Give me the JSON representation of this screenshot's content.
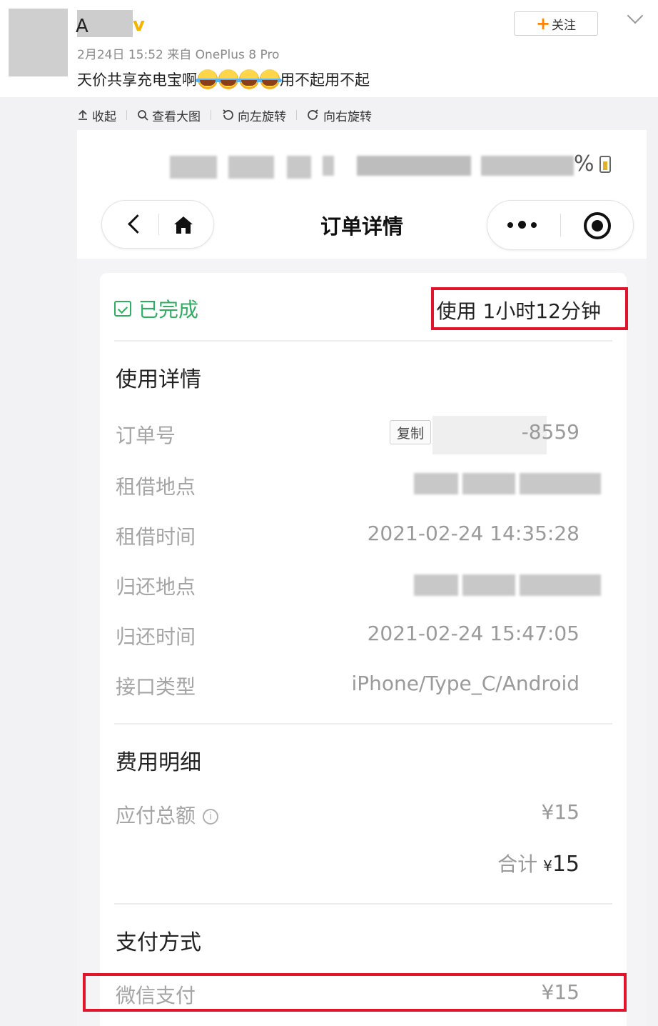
{
  "post": {
    "username_initial": "A",
    "verified_badge": "v",
    "meta": "2月24日 15:52 来自 OnePlus 8 Pro",
    "text_before": "天价共享充电宝啊",
    "emoji_icons": [
      "laugh-cry-emoji",
      "laugh-cry-emoji",
      "laugh-cry-emoji",
      "laugh-cry-emoji"
    ],
    "text_after": "用不起用不起",
    "follow_plus": "+",
    "follow_label": "关注"
  },
  "toolbar": {
    "collapse": "收起",
    "view_large": "查看大图",
    "rotate_left": "向左旋转",
    "rotate_right": "向右旋转"
  },
  "phone": {
    "status_bar": {
      "battery_suffix": "%"
    },
    "nav": {
      "title": "订单详情"
    },
    "order": {
      "status": "已完成",
      "duration": "使用 1小时12分钟",
      "usage_section": "使用详情",
      "rows": [
        {
          "label": "订单号",
          "value": "-8559"
        },
        {
          "label": "租借地点",
          "value": ""
        },
        {
          "label": "租借时间",
          "value": "2021-02-24 14:35:28"
        },
        {
          "label": "归还地点",
          "value": ""
        },
        {
          "label": "归还时间",
          "value": "2021-02-24 15:47:05"
        },
        {
          "label": "接口类型",
          "value": "iPhone/Type_C/Android"
        }
      ],
      "copy_label": "复制",
      "fee_section": "费用明细",
      "payable_label": "应付总额",
      "info_glyph": "i",
      "payable_value": "¥15",
      "total_label": "合计",
      "total_currency": "¥",
      "total_value": "15",
      "payment_section": "支付方式",
      "payment_method": "微信支付",
      "payment_value": "¥15"
    }
  },
  "colors": {
    "status_green": "#2fae62",
    "highlight_red": "#e0142a",
    "follow_orange": "#ff8200",
    "verified_gold": "#f5b400"
  }
}
